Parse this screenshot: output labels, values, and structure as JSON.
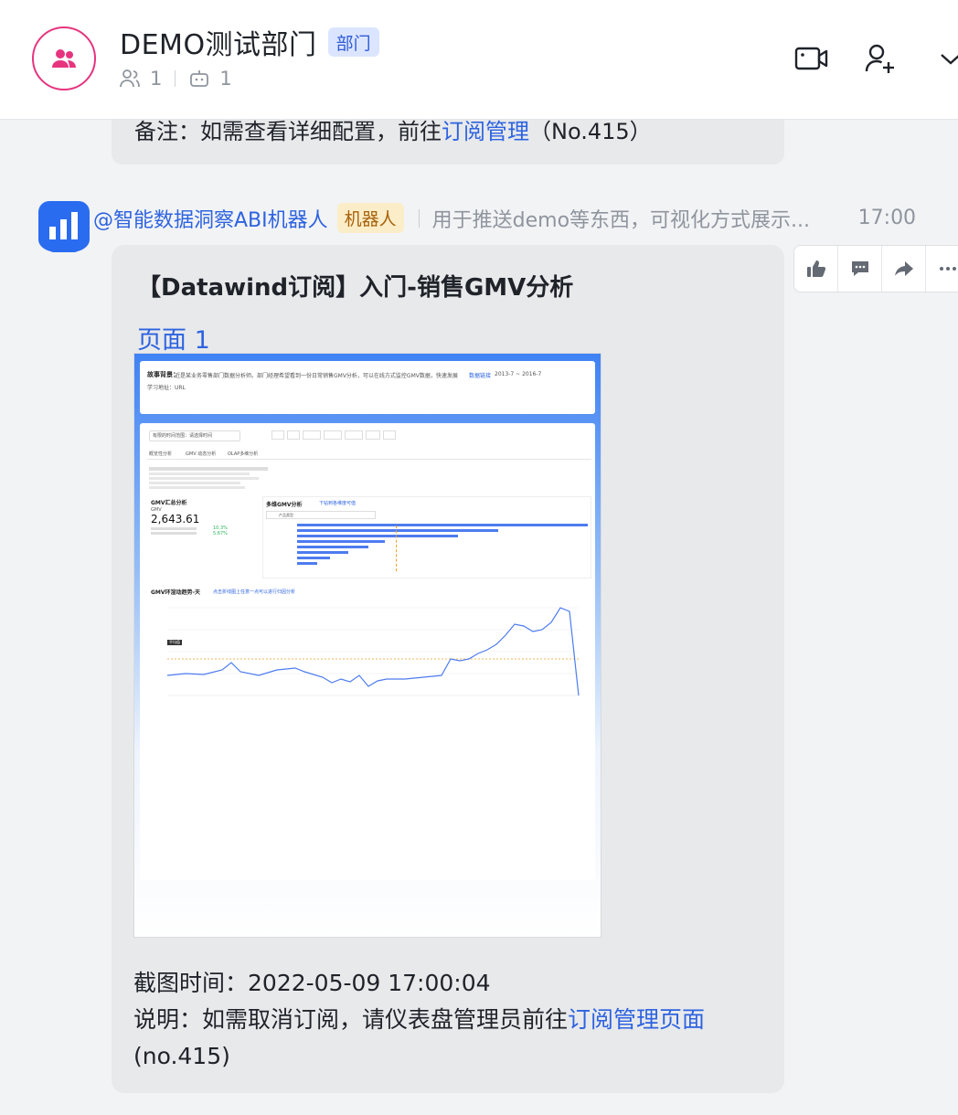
{
  "header": {
    "title": "DEMO测试部门",
    "tag": "部门",
    "member_count": "1",
    "bot_count": "1"
  },
  "previous_message": {
    "prefix": "备注：如需查看详细配置，前往",
    "link": "订阅管理",
    "suffix": "（No.415）"
  },
  "message": {
    "sender": "@智能数据洞察ABI机器人",
    "sender_tag": "机器人",
    "sender_desc": "用于推送demo等东西，可视化方式展示...",
    "time": "17:00",
    "card_title": "【Datawind订阅】入门-销售GMV分析",
    "page_link": "页面 1",
    "snapshot": {
      "intro_label": "故事背景：",
      "intro_text": "近是某业务零售部门数据分析师。部门经理希望看到一份日常销售GMV分析，可以在线方式监控GMV数据，快速发展情况数据全面发展。",
      "intro_link": "数据链接",
      "intro_date": "2013-7 ~ 2016-7",
      "url_label": "学习地址：URL",
      "filter_text": "有限的时间范围：请选择时间",
      "tabs": [
        "概览性分析",
        "GMV 动态分析",
        "OLAP多维分析"
      ],
      "kpi_title": "GMV汇总分析",
      "kpi_label": "GMV",
      "kpi_value": "2,643.61",
      "kpi_pct1": "10.3%",
      "kpi_pct2": "5.67%",
      "bar_title": "多维GMV分析",
      "bar_link": "下钻到各维度可值",
      "bar_dropdown": "产品类型",
      "line_title": "GMV环渲动趋势-天",
      "line_link": "点击折线图上任意一点可以进行归因分析",
      "avg_label": "平均值"
    },
    "capture_label": "截图时间：",
    "capture_time": "2022-05-09 17:00:04",
    "note_prefix": "说明：如需取消订阅，请仪表盘管理员前往",
    "note_link": "订阅管理页面",
    "note_suffix": " (no.415)"
  },
  "colors": {
    "accent": "#2d63e0",
    "group_avatar": "#e6347f",
    "bot_tag_bg": "#fbedc7",
    "dept_tag_bg": "#dbe5ff"
  },
  "icons": [
    "group-icon",
    "members-icon",
    "robot-icon",
    "video-call-icon",
    "add-member-icon",
    "chevron-down-icon",
    "thumbs-up-icon",
    "comment-icon",
    "forward-icon",
    "more-icon"
  ]
}
